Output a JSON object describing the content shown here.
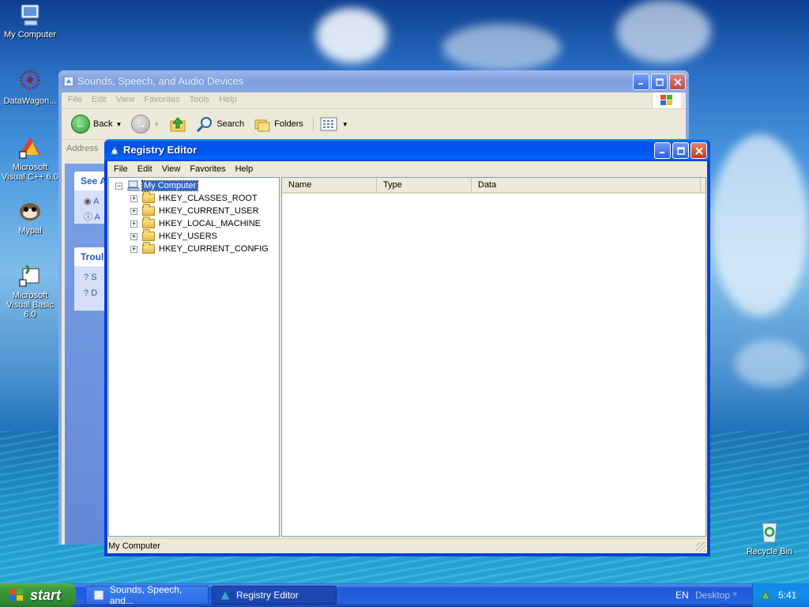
{
  "desktop": {
    "icons": [
      {
        "label": "My Computer",
        "icon": "my-computer-icon"
      },
      {
        "label": "DataWagon...",
        "icon": "datawagon-icon"
      },
      {
        "label": "Microsoft Visual C++ 6.0",
        "icon": "visual-cpp-icon"
      },
      {
        "label": "Mypal",
        "icon": "mypal-icon"
      },
      {
        "label": "Microsoft Visual Basic 6.0",
        "icon": "visual-basic-icon"
      },
      {
        "label": "Recycle Bin",
        "icon": "recycle-bin-icon"
      }
    ]
  },
  "sounds_window": {
    "title": "Sounds, Speech, and Audio Devices",
    "menu": [
      "File",
      "Edit",
      "View",
      "Favorites",
      "Tools",
      "Help"
    ],
    "toolbar": {
      "back": "Back",
      "search": "Search",
      "folders": "Folders"
    },
    "address_label": "Address",
    "panels": [
      {
        "heading": "See A",
        "items": [
          "A",
          "A"
        ]
      },
      {
        "heading": "Troul",
        "items": [
          "S",
          "D"
        ]
      }
    ]
  },
  "regedit": {
    "title": "Registry Editor",
    "menu": [
      "File",
      "Edit",
      "View",
      "Favorites",
      "Help"
    ],
    "tree": {
      "root": "My Computer",
      "keys": [
        "HKEY_CLASSES_ROOT",
        "HKEY_CURRENT_USER",
        "HKEY_LOCAL_MACHINE",
        "HKEY_USERS",
        "HKEY_CURRENT_CONFIG"
      ]
    },
    "columns": [
      "Name",
      "Type",
      "Data"
    ],
    "status": "My Computer"
  },
  "taskbar": {
    "start": "start",
    "tasks": [
      {
        "label": "Sounds, Speech, and...",
        "active": false
      },
      {
        "label": "Registry Editor",
        "active": true
      }
    ],
    "language": "EN",
    "desktop_toolbar": "Desktop",
    "chevron": "»",
    "clock": "5:41"
  },
  "colors": {
    "xp_blue": "#0050ee",
    "start_green": "#3c9c3c",
    "selection": "#316ac5"
  }
}
